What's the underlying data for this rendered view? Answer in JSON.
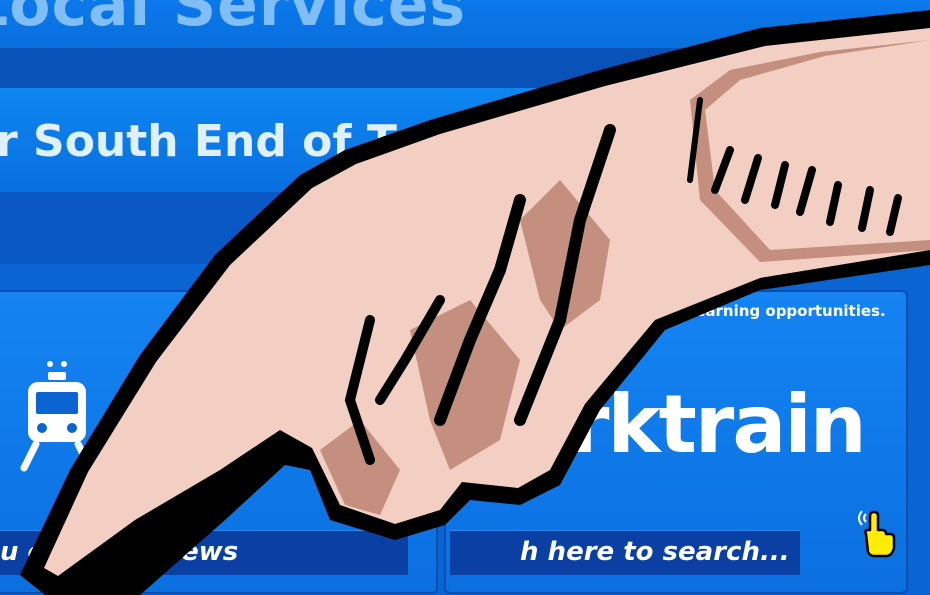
{
  "banner": {
    "title": "Local Services"
  },
  "header": {
    "subtitle": "r South End of T"
  },
  "promo": {
    "text": "00 learning opportunities."
  },
  "logo": {
    "text": "rktrain"
  },
  "search": {
    "left_text": "u    or travel news",
    "right_text": "h here to search..."
  },
  "icons": {
    "train": "train-icon",
    "bus": "bus-icon",
    "pointer": "hand-pointer-icon",
    "hand": "pointing-hand-illustration"
  },
  "colors": {
    "background": "#0a64d2",
    "panel": "#1484f2",
    "search_bar": "#0a3fa4",
    "skin": "#f2cfc2",
    "skin_shadow": "#c48f7f"
  }
}
